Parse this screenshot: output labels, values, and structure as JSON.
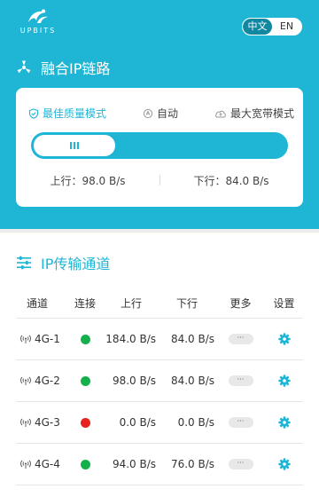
{
  "header": {
    "logo_text": "UPBITS",
    "lang": {
      "active": "中文",
      "inactive": "EN"
    },
    "title": "融合IP链路"
  },
  "modes": [
    {
      "label": "最佳质量模式",
      "icon": "shield-check-icon"
    },
    {
      "label": "自动",
      "icon": "auto-icon"
    },
    {
      "label": "最大宽带模式",
      "icon": "cloud-up-icon"
    }
  ],
  "rates": {
    "up": "上行：98.0 B/s",
    "down": "下行：84.0 B/s"
  },
  "channels": {
    "title": "IP传输通道",
    "headers": [
      "通道",
      "连接",
      "上行",
      "下行",
      "更多",
      "设置"
    ],
    "rows": [
      {
        "name": "4G-1",
        "status_color": "#13b04b",
        "up": "184.0 B/s",
        "down": "84.0 B/s",
        "more": "···"
      },
      {
        "name": "4G-2",
        "status_color": "#13b04b",
        "up": "98.0 B/s",
        "down": "84.0 B/s",
        "more": "···"
      },
      {
        "name": "4G-3",
        "status_color": "#e8231f",
        "up": "0.0 B/s",
        "down": "0.0 B/s",
        "more": "···"
      },
      {
        "name": "4G-4",
        "status_color": "#13b04b",
        "up": "94.0 B/s",
        "down": "76.0 B/s",
        "more": "···"
      }
    ]
  },
  "colors": {
    "accent": "#1fb6d5",
    "connected": "#13b04b",
    "disconnected": "#e8231f"
  }
}
